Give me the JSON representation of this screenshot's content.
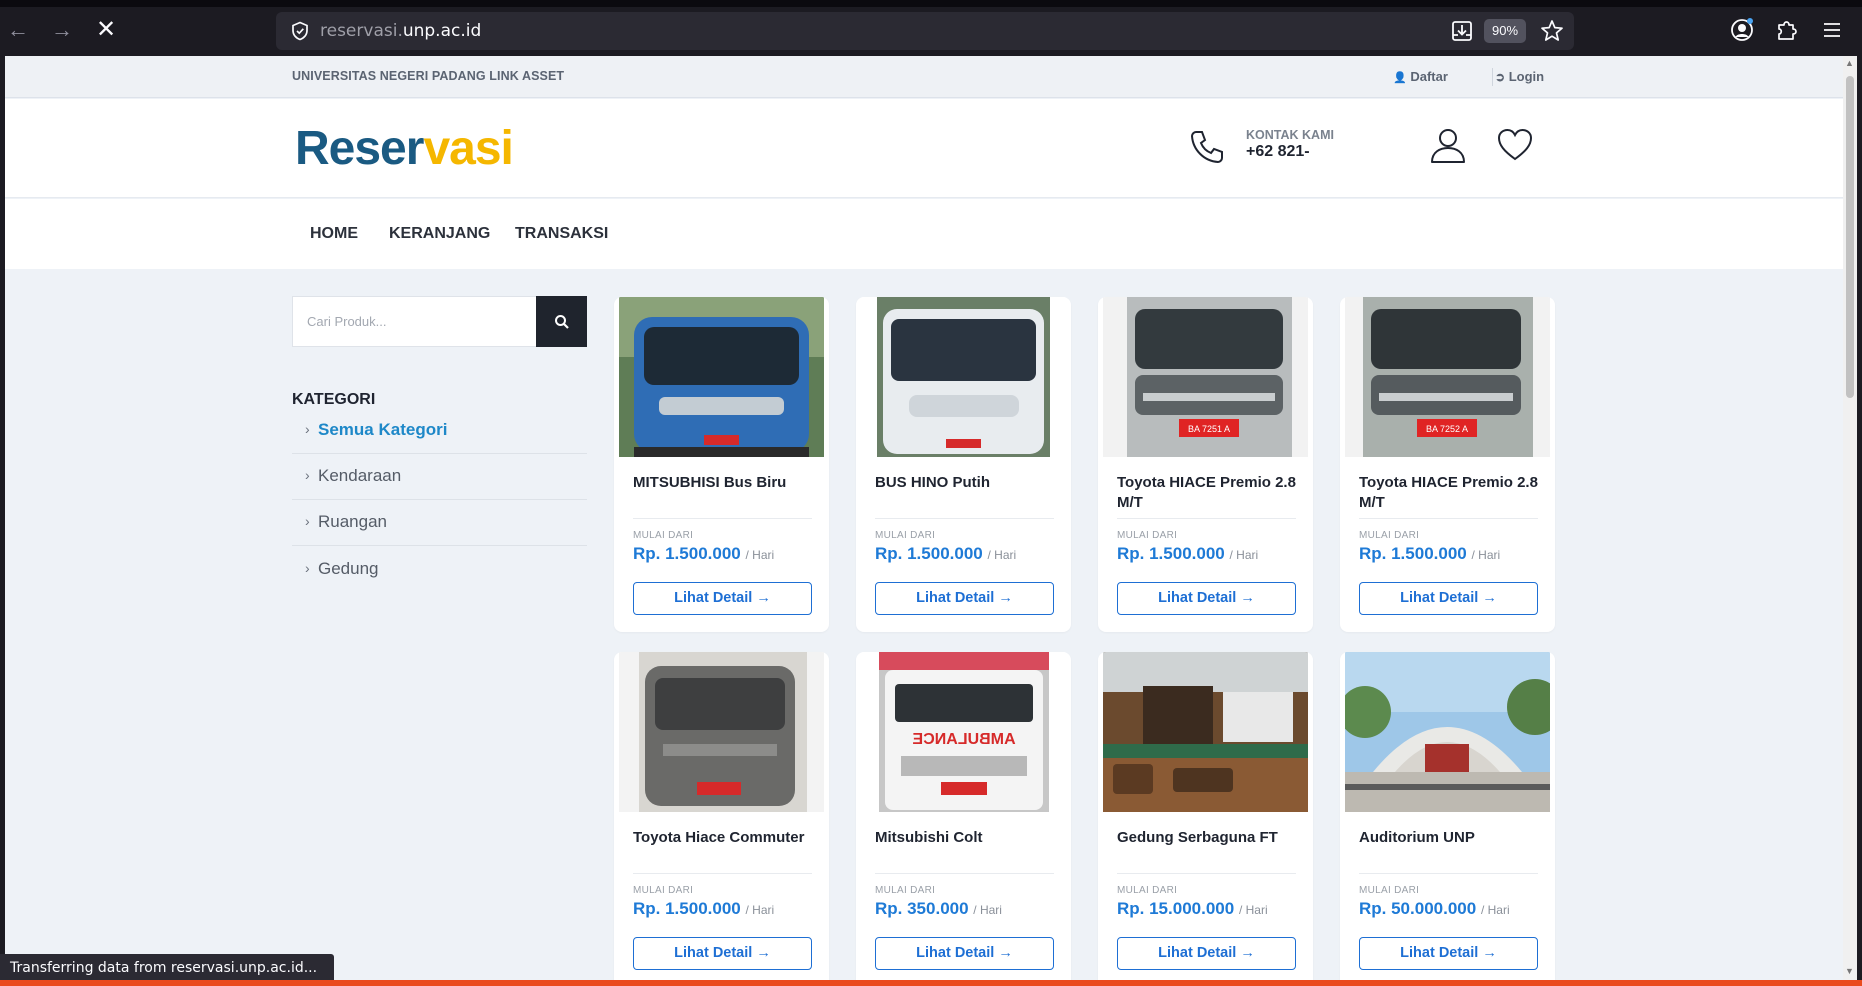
{
  "browser": {
    "url_prefix": "reservasi.",
    "url_domain": "unp.ac.id",
    "zoom": "90%",
    "status": "Transferring data from reservasi.unp.ac.id..."
  },
  "topbar": {
    "brand": "UNIVERSITAS NEGERI PADANG LINK ASSET",
    "daftar": "Daftar",
    "login": "Login"
  },
  "header": {
    "logo_a": "Reser",
    "logo_b": "vasi",
    "contact_label": "KONTAK KAMI",
    "contact_number": "+62 821-"
  },
  "menu": [
    "HOME",
    "KERANJANG",
    "TRANSAKSI"
  ],
  "search": {
    "placeholder": "Cari Produk..."
  },
  "sidebar": {
    "title": "KATEGORI",
    "items": [
      "Semua Kategori",
      "Kendaraan",
      "Ruangan",
      "Gedung"
    ]
  },
  "products": [
    {
      "name": "MITSUBHISI Bus Biru",
      "mulai": "MULAI DARI",
      "price": "Rp. 1.500.000",
      "unit": "/ Hari",
      "button": "Lihat Detail →"
    },
    {
      "name": "BUS HINO Putih",
      "mulai": "MULAI DARI",
      "price": "Rp. 1.500.000",
      "unit": "/ Hari",
      "button": "Lihat Detail →"
    },
    {
      "name": "Toyota HIACE Premio 2.8 M/T",
      "mulai": "MULAI DARI",
      "price": "Rp. 1.500.000",
      "unit": "/ Hari",
      "button": "Lihat Detail →",
      "plate": "BA 7251 A"
    },
    {
      "name": "Toyota HIACE Premio 2.8 M/T",
      "mulai": "MULAI DARI",
      "price": "Rp. 1.500.000",
      "unit": "/ Hari",
      "button": "Lihat Detail →",
      "plate": "BA 7252 A"
    },
    {
      "name": "Toyota Hiace Commuter",
      "mulai": "MULAI DARI",
      "price": "Rp. 1.500.000",
      "unit": "/ Hari",
      "button": "Lihat Detail →"
    },
    {
      "name": "Mitsubishi Colt",
      "mulai": "MULAI DARI",
      "price": "Rp. 350.000",
      "unit": "/ Hari",
      "button": "Lihat Detail →",
      "sign": "AMBULANCE"
    },
    {
      "name": "Gedung Serbaguna FT",
      "mulai": "MULAI DARI",
      "price": "Rp. 15.000.000",
      "unit": "/ Hari",
      "button": "Lihat Detail →"
    },
    {
      "name": "Auditorium UNP",
      "mulai": "MULAI DARI",
      "price": "Rp. 50.000.000",
      "unit": "/ Hari",
      "button": "Lihat Detail →"
    }
  ],
  "colors": {
    "accent": "#1e7ad6",
    "logo_blue": "#1a5a82",
    "logo_yellow": "#f5b700",
    "dark": "#1f242d"
  }
}
